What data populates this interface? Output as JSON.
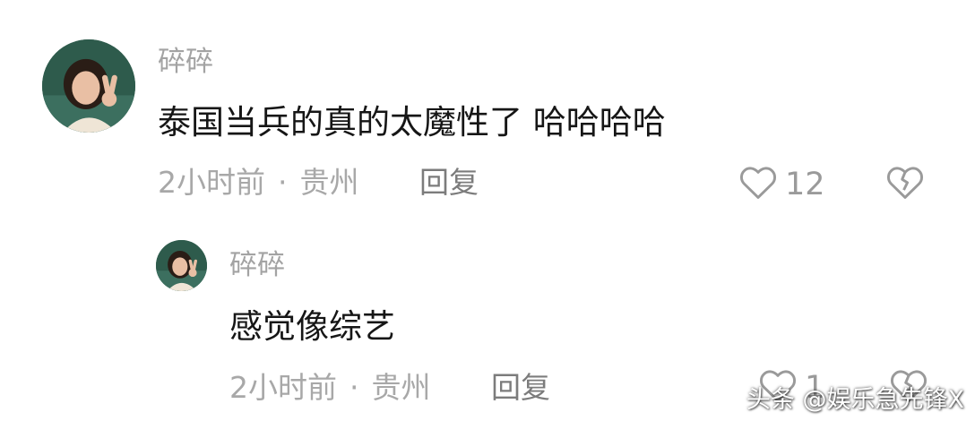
{
  "comment": {
    "username": "碎碎",
    "text": "泰国当兵的真的太魔性了 哈哈哈哈",
    "time": "2小时前",
    "separator": "·",
    "location": "贵州",
    "reply_label": "回复",
    "like_count": "12",
    "like_icon": "heart-outline-icon",
    "dislike_icon": "broken-heart-icon"
  },
  "reply": {
    "username": "碎碎",
    "text": "感觉像综艺",
    "time": "2小时前",
    "separator": "·",
    "location": "贵州",
    "reply_label": "回复",
    "like_count": "1",
    "like_icon": "heart-outline-icon",
    "dislike_icon": "broken-heart-icon"
  },
  "watermark": "头条 @娱乐急先锋X",
  "colors": {
    "username": "#a3a3a3",
    "content": "#161616",
    "meta": "#a8a8a8",
    "reply_button": "#7c7c7c",
    "icon": "#9a9a9a"
  }
}
